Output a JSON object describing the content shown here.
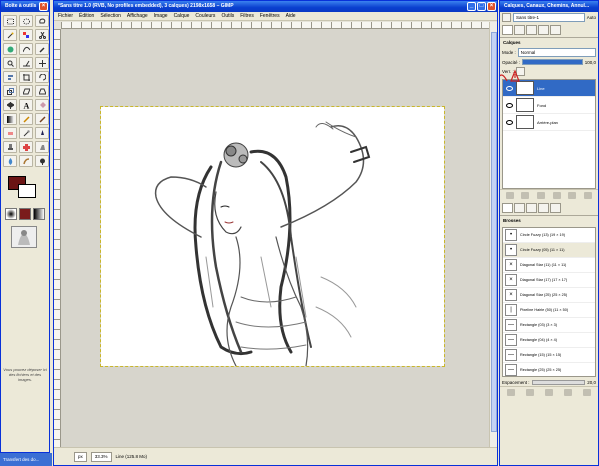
{
  "toolbox": {
    "title": "Boîte à outils",
    "hint_text": "Vous pouvez déposer ici des fichiers et des images."
  },
  "image_window": {
    "title": "*Sans titre 1.0 (RVB, No profiles embedded), 3 calques) 2198x1658 – GIMP",
    "menus": [
      "Fichier",
      "Édition",
      "Sélection",
      "Affichage",
      "Image",
      "Calque",
      "Couleurs",
      "Outils",
      "Filtres",
      "Fenêtres",
      "Aide"
    ],
    "status": {
      "unit": "px",
      "zoom": "33.3%",
      "info": "Line (125.8 Mo)"
    }
  },
  "dock": {
    "title": "Calques, Canaux, Chemins, Annul...",
    "image_select": "Sans titre-1",
    "auto_label": "Auto",
    "layers_label": "Calques",
    "mode_label": "Mode :",
    "mode_value": "Normal",
    "opacity_label": "Opacité :",
    "opacity_value": "100,0",
    "lock_label": "Verr. :",
    "layers": [
      {
        "name": "Line",
        "selected": true
      },
      {
        "name": "Fond",
        "selected": false
      },
      {
        "name": "Arrière-plan",
        "selected": false
      }
    ],
    "history_label": "Brosses",
    "history": [
      {
        "label": "Circle Fuzzy (13) (19 × 19)",
        "icon": "•"
      },
      {
        "label": "Circle Fuzzy (05) (11 × 11)",
        "icon": "•"
      },
      {
        "label": "Diagonal Star (11) (11 × 11)",
        "icon": "×"
      },
      {
        "label": "Diagonal Star (17) (17 × 17)",
        "icon": "×"
      },
      {
        "label": "Diagonal Star (25) (25 × 25)",
        "icon": "×"
      },
      {
        "label": "Pixeline Hairle (50) (11 × 50)",
        "icon": "|"
      },
      {
        "label": "Rectangle (03) (3 × 3)",
        "icon": "—"
      },
      {
        "label": "Rectangle (04) (4 × 4)",
        "icon": "—"
      },
      {
        "label": "Rectangle (15) (15 × 15)",
        "icon": "—"
      },
      {
        "label": "Rectangle (25) (25 × 25)",
        "icon": "—"
      }
    ],
    "spacing_label": "Espacement :",
    "spacing_value": "20,0"
  },
  "taskbar": {
    "item": "Transfert des do..."
  },
  "colors": {
    "foreground": "#6b1414",
    "background": "#ffffff",
    "accent": "#0a3fcf"
  }
}
